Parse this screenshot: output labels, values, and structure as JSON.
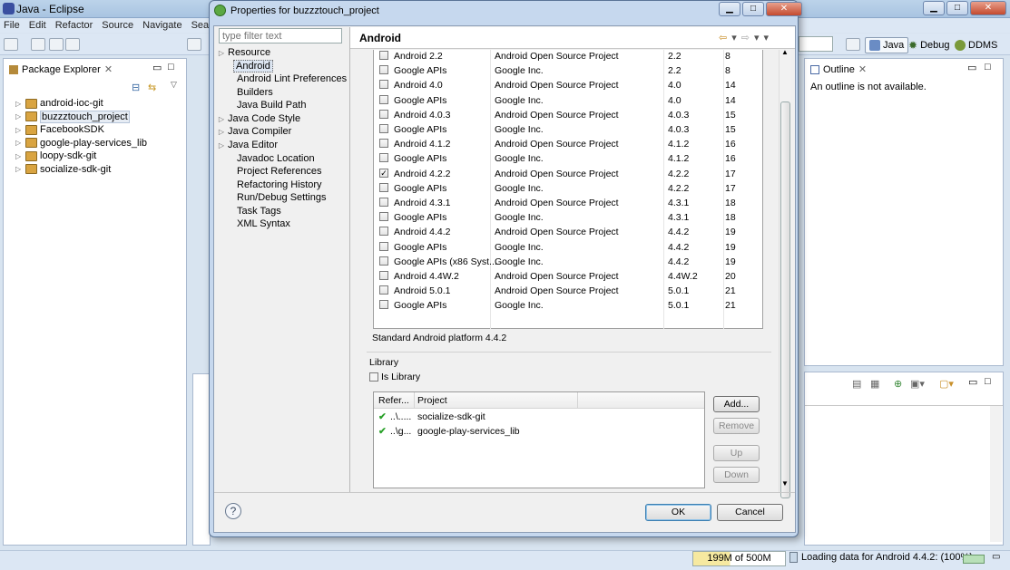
{
  "app": {
    "window_title": "Java - Eclipse",
    "menu": [
      "File",
      "Edit",
      "Refactor",
      "Source",
      "Navigate",
      "Search"
    ],
    "perspectives": [
      {
        "label": "Java",
        "active": true
      },
      {
        "label": "Debug",
        "active": false
      },
      {
        "label": "DDMS",
        "active": false
      }
    ]
  },
  "package_explorer": {
    "title": "Package Explorer",
    "projects": [
      "android-ioc-git",
      "buzzztouch_project",
      "FacebookSDK",
      "google-play-services_lib",
      "loopy-sdk-git",
      "socialize-sdk-git"
    ],
    "selected": "buzzztouch_project"
  },
  "outline": {
    "title": "Outline",
    "message": "An outline is not available."
  },
  "dialog": {
    "title": "Properties for buzzztouch_project",
    "filter_placeholder": "type filter text",
    "nav": [
      {
        "label": "Resource",
        "expandable": true
      },
      {
        "label": "Android",
        "expandable": false,
        "selected": true
      },
      {
        "label": "Android Lint Preferences",
        "expandable": false
      },
      {
        "label": "Builders",
        "expandable": false
      },
      {
        "label": "Java Build Path",
        "expandable": false
      },
      {
        "label": "Java Code Style",
        "expandable": true
      },
      {
        "label": "Java Compiler",
        "expandable": true
      },
      {
        "label": "Java Editor",
        "expandable": true
      },
      {
        "label": "Javadoc Location",
        "expandable": false
      },
      {
        "label": "Project References",
        "expandable": false
      },
      {
        "label": "Refactoring History",
        "expandable": false
      },
      {
        "label": "Run/Debug Settings",
        "expandable": false
      },
      {
        "label": "Task Tags",
        "expandable": false
      },
      {
        "label": "XML Syntax",
        "expandable": false
      }
    ],
    "page_title": "Android",
    "targets": [
      {
        "name": "Android 2.2",
        "vendor": "Android Open Source Project",
        "platform": "2.2",
        "api": "8",
        "checked": false
      },
      {
        "name": "Google APIs",
        "vendor": "Google Inc.",
        "platform": "2.2",
        "api": "8",
        "checked": false
      },
      {
        "name": "Android 4.0",
        "vendor": "Android Open Source Project",
        "platform": "4.0",
        "api": "14",
        "checked": false
      },
      {
        "name": "Google APIs",
        "vendor": "Google Inc.",
        "platform": "4.0",
        "api": "14",
        "checked": false
      },
      {
        "name": "Android 4.0.3",
        "vendor": "Android Open Source Project",
        "platform": "4.0.3",
        "api": "15",
        "checked": false
      },
      {
        "name": "Google APIs",
        "vendor": "Google Inc.",
        "platform": "4.0.3",
        "api": "15",
        "checked": false
      },
      {
        "name": "Android 4.1.2",
        "vendor": "Android Open Source Project",
        "platform": "4.1.2",
        "api": "16",
        "checked": false
      },
      {
        "name": "Google APIs",
        "vendor": "Google Inc.",
        "platform": "4.1.2",
        "api": "16",
        "checked": false
      },
      {
        "name": "Android 4.2.2",
        "vendor": "Android Open Source Project",
        "platform": "4.2.2",
        "api": "17",
        "checked": true
      },
      {
        "name": "Google APIs",
        "vendor": "Google Inc.",
        "platform": "4.2.2",
        "api": "17",
        "checked": false
      },
      {
        "name": "Android 4.3.1",
        "vendor": "Android Open Source Project",
        "platform": "4.3.1",
        "api": "18",
        "checked": false
      },
      {
        "name": "Google APIs",
        "vendor": "Google Inc.",
        "platform": "4.3.1",
        "api": "18",
        "checked": false
      },
      {
        "name": "Android 4.4.2",
        "vendor": "Android Open Source Project",
        "platform": "4.4.2",
        "api": "19",
        "checked": false
      },
      {
        "name": "Google APIs",
        "vendor": "Google Inc.",
        "platform": "4.4.2",
        "api": "19",
        "checked": false
      },
      {
        "name": "Google APIs (x86 Syst...",
        "vendor": "Google Inc.",
        "platform": "4.4.2",
        "api": "19",
        "checked": false
      },
      {
        "name": "Android 4.4W.2",
        "vendor": "Android Open Source Project",
        "platform": "4.4W.2",
        "api": "20",
        "checked": false
      },
      {
        "name": "Android 5.0.1",
        "vendor": "Android Open Source Project",
        "platform": "5.0.1",
        "api": "21",
        "checked": false
      },
      {
        "name": "Google APIs",
        "vendor": "Google Inc.",
        "platform": "5.0.1",
        "api": "21",
        "checked": false
      }
    ],
    "platform_text": "Standard Android platform 4.4.2",
    "library": {
      "group_label": "Library",
      "is_library_label": "Is Library",
      "is_library_checked": false,
      "columns": [
        "Refer...",
        "Project"
      ],
      "rows": [
        {
          "ref": "..\\.....",
          "project": "socialize-sdk-git"
        },
        {
          "ref": "..\\g...",
          "project": "google-play-services_lib"
        }
      ],
      "buttons": {
        "add": "Add...",
        "remove": "Remove",
        "up": "Up",
        "down": "Down"
      }
    },
    "ok_label": "OK",
    "cancel_label": "Cancel",
    "help_label": "?"
  },
  "status": {
    "heap": "199M of 500M",
    "message": "Loading data for Android 4.4.2: (100%)"
  }
}
